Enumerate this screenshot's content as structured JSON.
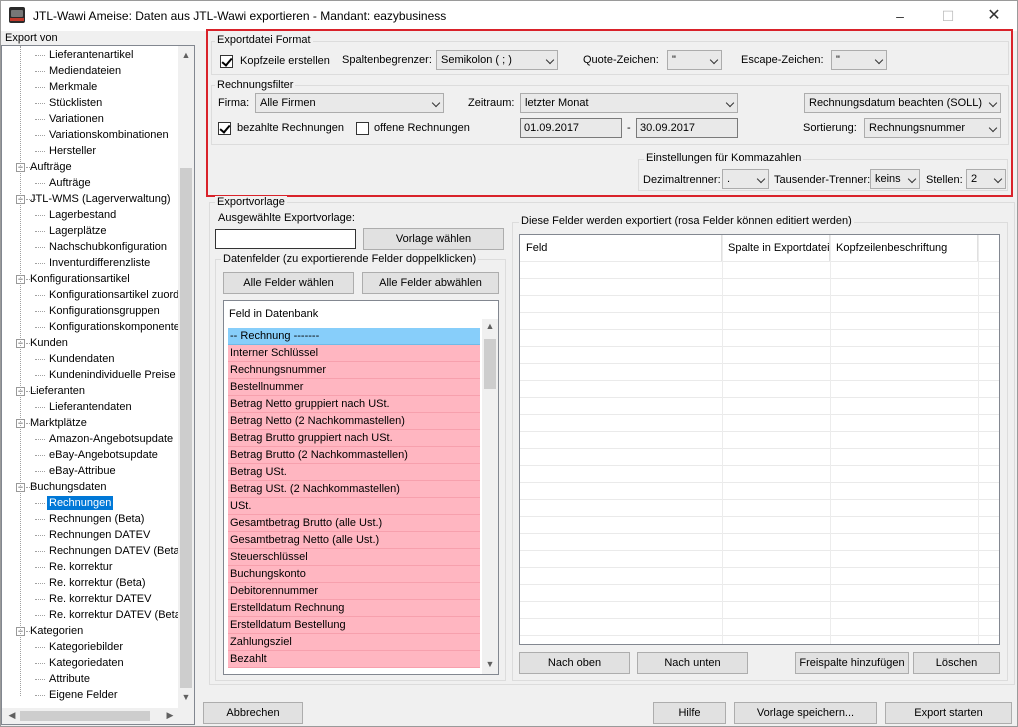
{
  "window": {
    "title": "JTL-Wawi Ameise: Daten aus JTL-Wawi exportieren - Mandant: eazybusiness",
    "icon": "ameise-app-icon"
  },
  "tree": {
    "label": "Export von",
    "nodes": [
      {
        "label": "Lieferantenartikel"
      },
      {
        "label": "Mediendateien"
      },
      {
        "label": "Merkmale"
      },
      {
        "label": "Stücklisten"
      },
      {
        "label": "Variationen"
      },
      {
        "label": "Variationskombinationen"
      },
      {
        "label": "Hersteller"
      },
      {
        "label": "Aufträge",
        "group": true
      },
      {
        "label": "Aufträge"
      },
      {
        "label": "JTL-WMS (Lagerverwaltung)",
        "group": true
      },
      {
        "label": "Lagerbestand"
      },
      {
        "label": "Lagerplätze"
      },
      {
        "label": "Nachschubkonfiguration"
      },
      {
        "label": "Inventurdifferenzliste"
      },
      {
        "label": "Konfigurationsartikel",
        "group": true
      },
      {
        "label": "Konfigurationsartikel zuordr"
      },
      {
        "label": "Konfigurationsgruppen"
      },
      {
        "label": "Konfigurationskomponenten"
      },
      {
        "label": "Kunden",
        "group": true
      },
      {
        "label": "Kundendaten"
      },
      {
        "label": "Kundenindividuelle Preise"
      },
      {
        "label": "Lieferanten",
        "group": true
      },
      {
        "label": "Lieferantendaten"
      },
      {
        "label": "Marktplätze",
        "group": true
      },
      {
        "label": "Amazon-Angebotsupdate"
      },
      {
        "label": "eBay-Angebotsupdate"
      },
      {
        "label": "eBay-Attribue"
      },
      {
        "label": "Buchungsdaten",
        "group": true
      },
      {
        "label": "Rechnungen",
        "selected": true
      },
      {
        "label": "Rechnungen (Beta)"
      },
      {
        "label": "Rechnungen DATEV"
      },
      {
        "label": "Rechnungen DATEV (Beta"
      },
      {
        "label": "Re. korrektur"
      },
      {
        "label": "Re. korrektur (Beta)"
      },
      {
        "label": "Re. korrektur DATEV"
      },
      {
        "label": "Re. korrektur DATEV (Beta"
      },
      {
        "label": "Kategorien",
        "group": true
      },
      {
        "label": "Kategoriebilder"
      },
      {
        "label": "Kategoriedaten"
      },
      {
        "label": "Attribute"
      },
      {
        "label": "Eigene Felder"
      }
    ]
  },
  "format": {
    "group_label": "Exportdatei Format",
    "header_checkbox": {
      "label": "Kopfzeile erstellen",
      "checked": true
    },
    "delimiter_label": "Spaltenbegrenzer:",
    "delimiter_value": "Semikolon ( ; )",
    "quote_label": "Quote-Zeichen:",
    "quote_value": "\"",
    "escape_label": "Escape-Zeichen:",
    "escape_value": "\""
  },
  "filter": {
    "group_label": "Rechnungsfilter",
    "company_label": "Firma:",
    "company_value": "Alle Firmen",
    "period_label": "Zeitraum:",
    "period_value": "letzter Monat",
    "date_mode_value": "Rechnungsdatum beachten (SOLL)",
    "paid": {
      "label": "bezahlte Rechnungen",
      "checked": true
    },
    "open": {
      "label": "offene Rechnungen",
      "checked": false
    },
    "date_from": "01.09.2017",
    "date_sep": "-",
    "date_to": "30.09.2017",
    "sort_label": "Sortierung:",
    "sort_value": "Rechnungsnummer"
  },
  "decimal": {
    "group_label": "Einstellungen für Kommazahlen",
    "dec_label": "Dezimaltrenner:",
    "dec_value": ".",
    "thousand_label": "Tausender-Trenner:",
    "thousand_value": "keins",
    "places_label": "Stellen:",
    "places_value": "2"
  },
  "template": {
    "group_label": "Exportvorlage",
    "selected_label": "Ausgewählte Exportvorlage:",
    "selected_value": "",
    "choose_button": "Vorlage wählen"
  },
  "datafields": {
    "group_label": "Datenfelder (zu exportierende Felder doppelklicken)",
    "select_all": "Alle Felder wählen",
    "deselect_all": "Alle Felder abwählen",
    "list_header": "Feld in Datenbank",
    "items": [
      {
        "label": "-- Rechnung -------",
        "color": "#87cefa"
      },
      {
        "label": "Interner Schlüssel"
      },
      {
        "label": "Rechnungsnummer"
      },
      {
        "label": "Bestellnummer"
      },
      {
        "label": "Betrag Netto gruppiert nach USt."
      },
      {
        "label": "Betrag Netto (2 Nachkommastellen)"
      },
      {
        "label": "Betrag Brutto gruppiert nach USt."
      },
      {
        "label": "Betrag Brutto (2 Nachkommastellen)"
      },
      {
        "label": "Betrag USt."
      },
      {
        "label": "Betrag USt. (2 Nachkommastellen)"
      },
      {
        "label": "USt."
      },
      {
        "label": "Gesamtbetrag Brutto (alle Ust.)"
      },
      {
        "label": "Gesamtbetrag Netto (alle Ust.)"
      },
      {
        "label": "Steuerschlüssel"
      },
      {
        "label": "Buchungskonto"
      },
      {
        "label": "Debitorennummer"
      },
      {
        "label": "Erstelldatum Rechnung"
      },
      {
        "label": "Erstelldatum Bestellung"
      },
      {
        "label": "Zahlungsziel"
      },
      {
        "label": "Bezahlt"
      }
    ],
    "pink_color": "#ffb6c1"
  },
  "exported": {
    "group_label": "Diese Felder werden exportiert (rosa Felder können editiert werden)",
    "columns": [
      "Feld",
      "Spalte in Exportdatei",
      "Kopfzeilenbeschriftung"
    ],
    "up": "Nach oben",
    "down": "Nach unten",
    "add_free": "Freispalte hinzufügen",
    "delete": "Löschen"
  },
  "footer": {
    "cancel": "Abbrechen",
    "help": "Hilfe",
    "save_template": "Vorlage speichern...",
    "start": "Export starten"
  },
  "colors": {
    "highlight": "#d9222a",
    "selection": "#0078d7"
  }
}
